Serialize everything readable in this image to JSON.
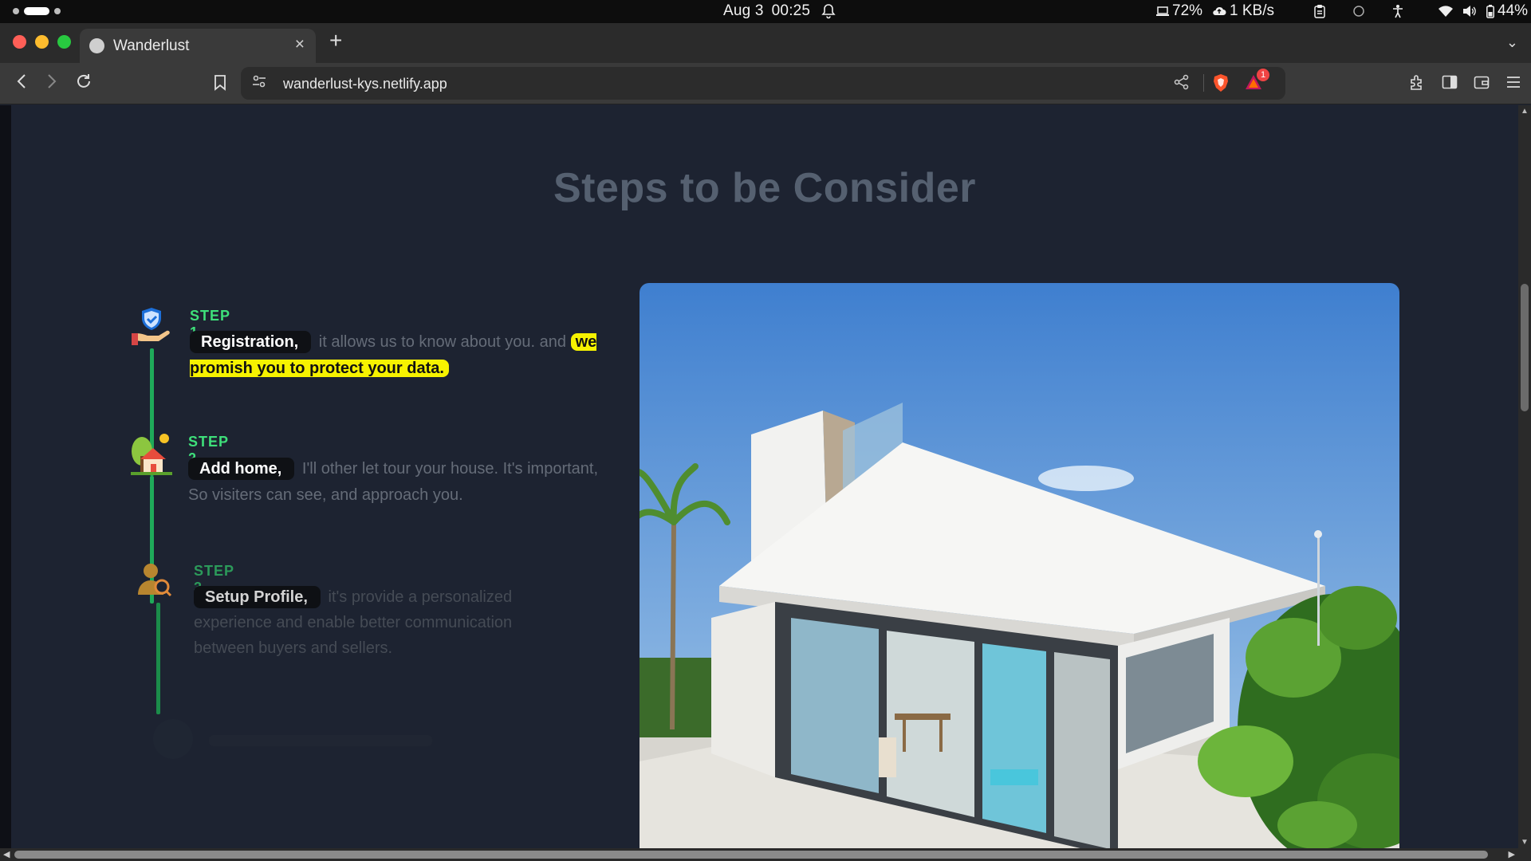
{
  "system_bar": {
    "date": "Aug 3",
    "time": "00:25",
    "battery_device": "72%",
    "network_speed": "1 KB/s",
    "battery": "44%"
  },
  "browser": {
    "tab_title": "Wanderlust",
    "url": "wanderlust-kys.netlify.app",
    "rewards_badge": "1"
  },
  "page": {
    "heading": "Steps to be Consider",
    "steps": [
      {
        "label": "STEP 1",
        "chip": "Registration,",
        "text_a": " it allows us to know about you. and ",
        "highlight": "we promish you to protect your data."
      },
      {
        "label": "STEP 2",
        "chip": "Add home,",
        "text_a": " I'll other let tour your house. It's important, So visiters can see, and approach you."
      },
      {
        "label": "STEP 3",
        "chip": "Setup Profile,",
        "text_a": " it's provide a personalized experience and enable better communication between buyers and sellers."
      }
    ]
  },
  "colors": {
    "page_bg": "#1d2331",
    "heading": "#556070",
    "step_green": "#3ee07a",
    "timeline": "#1faa59",
    "highlight": "#f6f200"
  }
}
